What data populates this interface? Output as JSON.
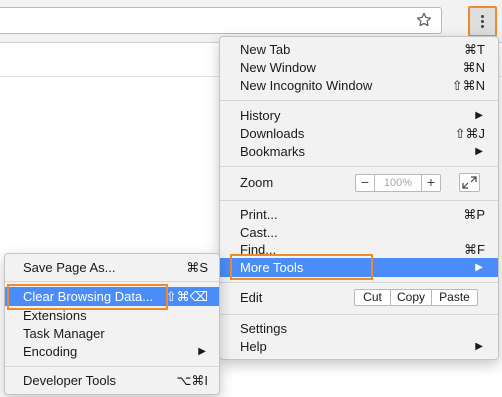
{
  "toolbar": {
    "star_icon": "bookmark-star-icon",
    "menu_icon": "kebab-menu-icon"
  },
  "main_menu": {
    "new_tab": {
      "label": "New Tab",
      "shortcut": "⌘T"
    },
    "new_window": {
      "label": "New Window",
      "shortcut": "⌘N"
    },
    "new_incognito": {
      "label": "New Incognito Window",
      "shortcut": "⇧⌘N"
    },
    "history": {
      "label": "History"
    },
    "downloads": {
      "label": "Downloads",
      "shortcut": "⇧⌘J"
    },
    "bookmarks": {
      "label": "Bookmarks"
    },
    "zoom": {
      "label": "Zoom",
      "minus": "−",
      "value": "100%",
      "plus": "+"
    },
    "print": {
      "label": "Print...",
      "shortcut": "⌘P"
    },
    "cast": {
      "label": "Cast..."
    },
    "find": {
      "label": "Find...",
      "shortcut": "⌘F"
    },
    "more_tools": {
      "label": "More Tools"
    },
    "edit": {
      "label": "Edit",
      "cut": "Cut",
      "copy": "Copy",
      "paste": "Paste"
    },
    "settings": {
      "label": "Settings"
    },
    "help": {
      "label": "Help"
    },
    "submenu_arrow": "▶"
  },
  "sub_menu": {
    "save_page": {
      "label": "Save Page As...",
      "shortcut": "⌘S"
    },
    "clear_browsing": {
      "label": "Clear Browsing Data...",
      "shortcut": "⇧⌘⌫"
    },
    "extensions": {
      "label": "Extensions"
    },
    "task_manager": {
      "label": "Task Manager"
    },
    "encoding": {
      "label": "Encoding"
    },
    "developer_tools": {
      "label": "Developer Tools",
      "shortcut": "⌥⌘I"
    }
  },
  "colors": {
    "highlight": "#4a8df8",
    "annotation": "#f08a2c",
    "menu_bg": "#f2f2f2"
  }
}
